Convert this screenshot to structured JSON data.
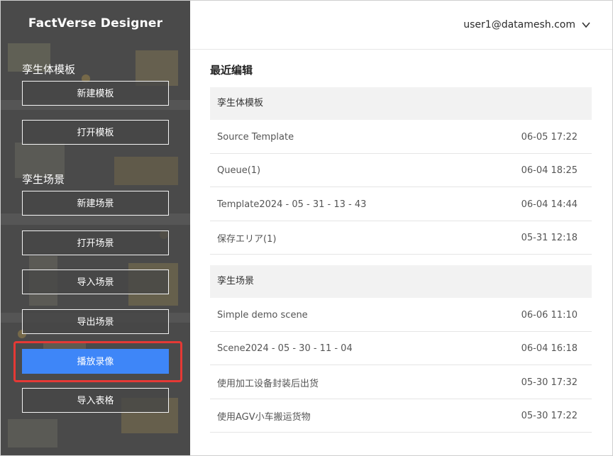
{
  "sidebar": {
    "app_title": "FactVerse Designer",
    "template_section": {
      "title": "孪生体模板",
      "buttons": [
        "新建模板",
        "打开模板"
      ]
    },
    "scene_section": {
      "title": "孪生场景",
      "buttons": [
        "新建场景",
        "打开场景",
        "导入场景",
        "导出场景",
        "播放录像",
        "导入表格"
      ]
    },
    "highlighted_button": "播放录像",
    "accent_color": "#3e86f8",
    "highlight_color": "#e53935"
  },
  "header": {
    "user_email": "user1@datamesh.com",
    "menu_icon": "chevron-down-icon"
  },
  "main": {
    "recent_title": "最近编辑",
    "groups": [
      {
        "title": "孪生体模板",
        "items": [
          {
            "name": "Source Template",
            "time": "06-05 17:22"
          },
          {
            "name": "Queue(1)",
            "time": "06-04 18:25"
          },
          {
            "name": "Template2024 - 05 - 31 - 13 - 43",
            "time": "06-04 14:44"
          },
          {
            "name": "保存エリア(1)",
            "time": "05-31 12:18"
          }
        ]
      },
      {
        "title": "孪生场景",
        "items": [
          {
            "name": "Simple demo scene",
            "time": "06-06 11:10"
          },
          {
            "name": "Scene2024 - 05 - 30 - 11 - 04",
            "time": "06-04 16:18"
          },
          {
            "name": "使用加工设备封装后出货",
            "time": "05-30 17:32"
          },
          {
            "name": "使用AGV小车搬运货物",
            "time": "05-30 17:22"
          }
        ]
      }
    ]
  }
}
